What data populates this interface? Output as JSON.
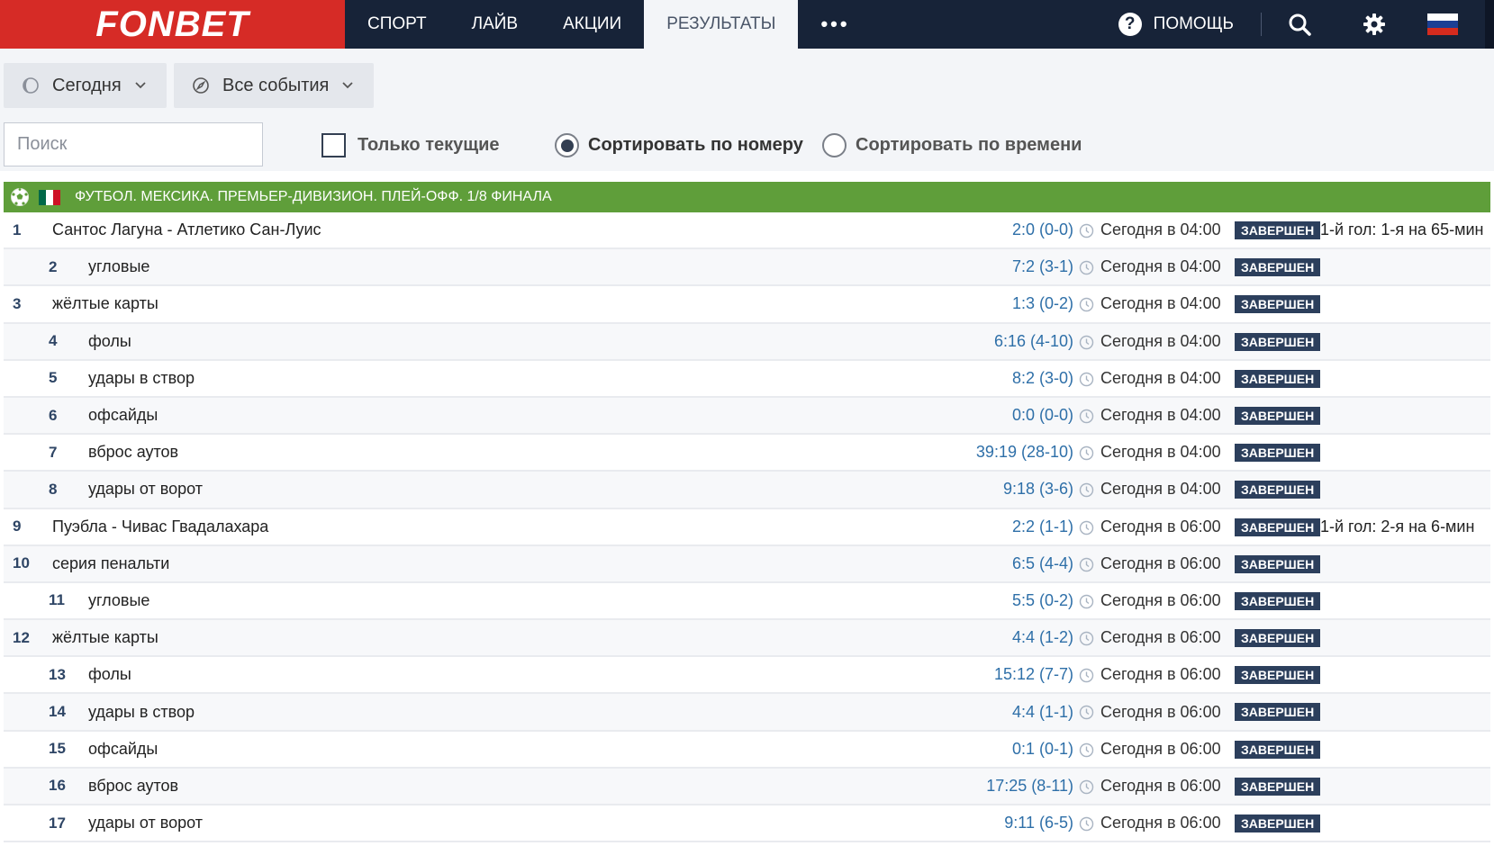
{
  "brand": {
    "logo_text": "FONBET",
    "logo_color": "#d62b26",
    "nav_bg": "#172338"
  },
  "nav": {
    "items": [
      "СПОРТ",
      "ЛАЙВ",
      "АКЦИИ",
      "РЕЗУЛЬТАТЫ"
    ],
    "active": "РЕЗУЛЬТАТЫ",
    "more_icon": "more-dots-icon"
  },
  "header_right": {
    "help_label": "ПОМОЩЬ",
    "help_icon": "question-icon",
    "search_icon": "search-icon",
    "settings_icon": "gear-icon",
    "flag": "russia-flag"
  },
  "filters": {
    "date_dropdown": "Сегодня",
    "events_dropdown": "Все события",
    "search_placeholder": "Поиск",
    "only_current_label": "Только текущие",
    "only_current_checked": false,
    "sort_by_number_label": "Сортировать по номеру",
    "sort_by_time_label": "Сортировать по времени",
    "sort_selected": "number"
  },
  "group": {
    "title": "ФУТБОЛ. МЕКСИКА. ПРЕМЬЕР-ДИВИЗИОН. ПЛЕЙ-ОФФ. 1/8 ФИНАЛА",
    "color": "#5f9e3a"
  },
  "rows": [
    {
      "num": "1",
      "name": "Сантос Лагуна - Атлетико Сан-Луис",
      "indent": false,
      "score": "2:0 (0-0)",
      "time": "Сегодня в 04:00",
      "status": "ЗАВЕРШЕН",
      "note": "1-й гол: 1-я на 65-мин"
    },
    {
      "num": "2",
      "name": "угловые",
      "indent": true,
      "score": "7:2 (3-1)",
      "time": "Сегодня в 04:00",
      "status": "ЗАВЕРШЕН",
      "note": ""
    },
    {
      "num": "3",
      "name": "жёлтые карты",
      "indent": false,
      "score": "1:3 (0-2)",
      "time": "Сегодня в 04:00",
      "status": "ЗАВЕРШЕН",
      "note": ""
    },
    {
      "num": "4",
      "name": "фолы",
      "indent": true,
      "score": "6:16 (4-10)",
      "time": "Сегодня в 04:00",
      "status": "ЗАВЕРШЕН",
      "note": ""
    },
    {
      "num": "5",
      "name": "удары в створ",
      "indent": true,
      "score": "8:2 (3-0)",
      "time": "Сегодня в 04:00",
      "status": "ЗАВЕРШЕН",
      "note": ""
    },
    {
      "num": "6",
      "name": "офсайды",
      "indent": true,
      "score": "0:0 (0-0)",
      "time": "Сегодня в 04:00",
      "status": "ЗАВЕРШЕН",
      "note": ""
    },
    {
      "num": "7",
      "name": "вброс аутов",
      "indent": true,
      "score": "39:19 (28-10)",
      "time": "Сегодня в 04:00",
      "status": "ЗАВЕРШЕН",
      "note": ""
    },
    {
      "num": "8",
      "name": "удары от ворот",
      "indent": true,
      "score": "9:18 (3-6)",
      "time": "Сегодня в 04:00",
      "status": "ЗАВЕРШЕН",
      "note": ""
    },
    {
      "num": "9",
      "name": "Пуэбла - Чивас Гвадалахара",
      "indent": false,
      "score": "2:2 (1-1)",
      "time": "Сегодня в 06:00",
      "status": "ЗАВЕРШЕН",
      "note": "1-й гол: 2-я на 6-мин"
    },
    {
      "num": "10",
      "name": "серия пенальти",
      "indent": false,
      "score": "6:5 (4-4)",
      "time": "Сегодня в 06:00",
      "status": "ЗАВЕРШЕН",
      "note": ""
    },
    {
      "num": "11",
      "name": "угловые",
      "indent": true,
      "score": "5:5 (0-2)",
      "time": "Сегодня в 06:00",
      "status": "ЗАВЕРШЕН",
      "note": ""
    },
    {
      "num": "12",
      "name": "жёлтые карты",
      "indent": false,
      "score": "4:4 (1-2)",
      "time": "Сегодня в 06:00",
      "status": "ЗАВЕРШЕН",
      "note": ""
    },
    {
      "num": "13",
      "name": "фолы",
      "indent": true,
      "score": "15:12 (7-7)",
      "time": "Сегодня в 06:00",
      "status": "ЗАВЕРШЕН",
      "note": ""
    },
    {
      "num": "14",
      "name": "удары в створ",
      "indent": true,
      "score": "4:4 (1-1)",
      "time": "Сегодня в 06:00",
      "status": "ЗАВЕРШЕН",
      "note": ""
    },
    {
      "num": "15",
      "name": "офсайды",
      "indent": true,
      "score": "0:1 (0-1)",
      "time": "Сегодня в 06:00",
      "status": "ЗАВЕРШЕН",
      "note": ""
    },
    {
      "num": "16",
      "name": "вброс аутов",
      "indent": true,
      "score": "17:25 (8-11)",
      "time": "Сегодня в 06:00",
      "status": "ЗАВЕРШЕН",
      "note": ""
    },
    {
      "num": "17",
      "name": "удары от ворот",
      "indent": true,
      "score": "9:11 (6-5)",
      "time": "Сегодня в 06:00",
      "status": "ЗАВЕРШЕН",
      "note": ""
    }
  ]
}
